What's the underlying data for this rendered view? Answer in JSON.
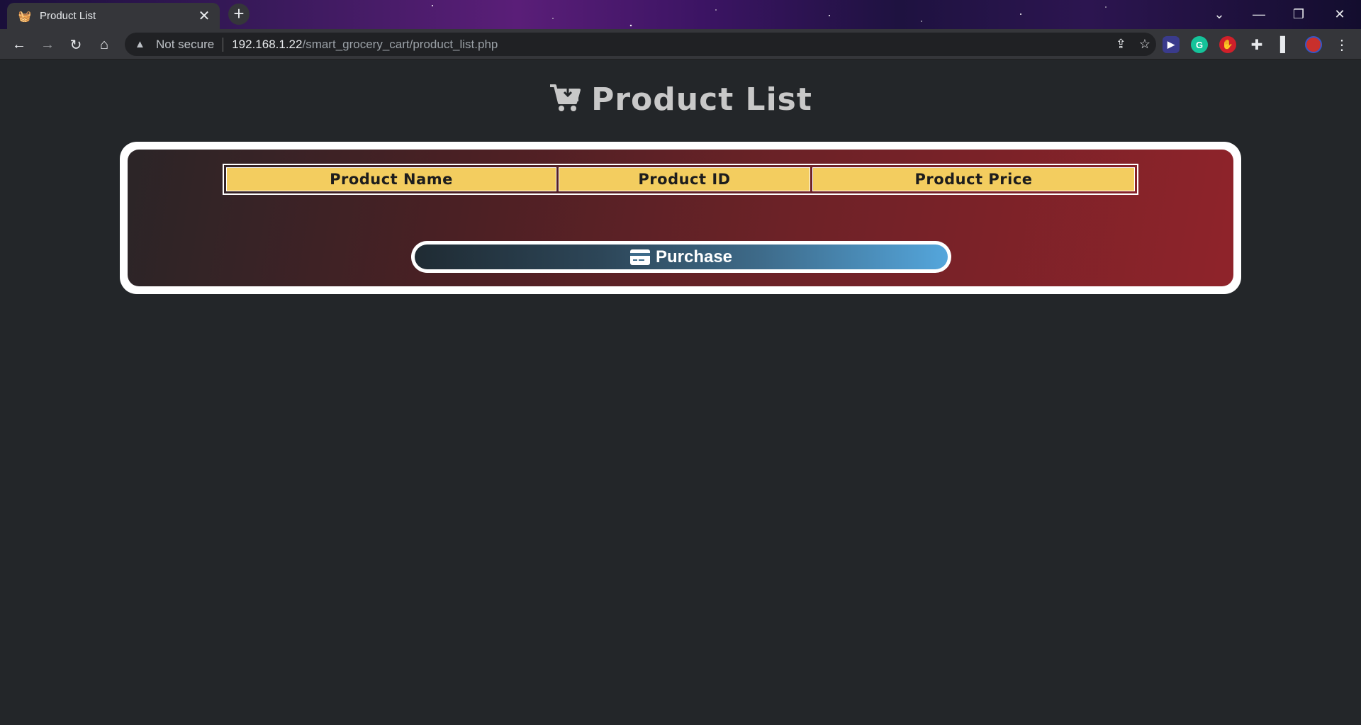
{
  "browser": {
    "tab_title": "Product List",
    "tab_close": "✕",
    "new_tab": "+",
    "security_label": "Not secure",
    "url_host": "192.168.1.22",
    "url_path": "/smart_grocery_cart/product_list.php"
  },
  "page": {
    "title": "Product List",
    "table_headers": [
      "Product Name",
      "Product ID",
      "Product Price"
    ],
    "purchase_label": "Purchase"
  },
  "colors": {
    "header_cell": "#f3cd5f",
    "panel_gradient_start": "#2b2527",
    "panel_gradient_end": "#8f232a",
    "button_gradient_end": "#54a6dc"
  }
}
